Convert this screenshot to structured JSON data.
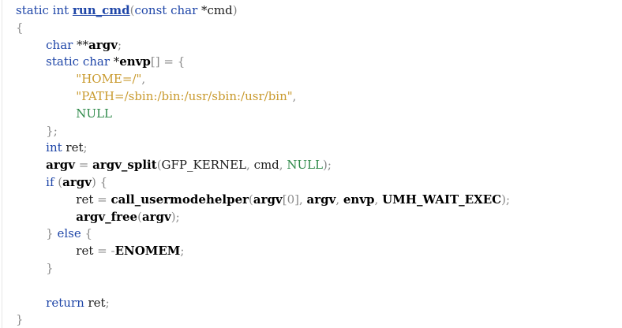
{
  "editor": {
    "lines": [
      [
        {
          "t": "static int ",
          "c": "kw"
        },
        {
          "t": "run_cmd",
          "c": "fn-def"
        },
        {
          "t": "(",
          "c": "punct"
        },
        {
          "t": "const char ",
          "c": "kw"
        },
        {
          "t": "*cmd",
          "c": "plain"
        },
        {
          "t": ")",
          "c": "punct"
        }
      ],
      [
        {
          "t": "{",
          "c": "punct"
        }
      ],
      [
        {
          "t": "        ",
          "c": "plain"
        },
        {
          "t": "char ",
          "c": "kw"
        },
        {
          "t": "**",
          "c": "plain"
        },
        {
          "t": "argv",
          "c": "bold"
        },
        {
          "t": ";",
          "c": "punct"
        }
      ],
      [
        {
          "t": "        ",
          "c": "plain"
        },
        {
          "t": "static char ",
          "c": "kw"
        },
        {
          "t": "*",
          "c": "plain"
        },
        {
          "t": "envp",
          "c": "bold"
        },
        {
          "t": "[] = {",
          "c": "punct"
        }
      ],
      [
        {
          "t": "                ",
          "c": "plain"
        },
        {
          "t": "\"HOME=/\"",
          "c": "str"
        },
        {
          "t": ",",
          "c": "punct"
        }
      ],
      [
        {
          "t": "                ",
          "c": "plain"
        },
        {
          "t": "\"PATH=/sbin:/bin:/usr/sbin:/usr/bin\"",
          "c": "str"
        },
        {
          "t": ",",
          "c": "punct"
        }
      ],
      [
        {
          "t": "                ",
          "c": "plain"
        },
        {
          "t": "NULL",
          "c": "const"
        }
      ],
      [
        {
          "t": "        ",
          "c": "plain"
        },
        {
          "t": "};",
          "c": "punct"
        }
      ],
      [
        {
          "t": "        ",
          "c": "plain"
        },
        {
          "t": "int ",
          "c": "kw"
        },
        {
          "t": "ret",
          "c": "plain"
        },
        {
          "t": ";",
          "c": "punct"
        }
      ],
      [
        {
          "t": "        ",
          "c": "plain"
        },
        {
          "t": "argv",
          "c": "bold"
        },
        {
          "t": " = ",
          "c": "punct"
        },
        {
          "t": "argv_split",
          "c": "bold"
        },
        {
          "t": "(",
          "c": "punct"
        },
        {
          "t": "GFP_KERNEL",
          "c": "plain"
        },
        {
          "t": ", ",
          "c": "punct"
        },
        {
          "t": "cmd",
          "c": "plain"
        },
        {
          "t": ", ",
          "c": "punct"
        },
        {
          "t": "NULL",
          "c": "const"
        },
        {
          "t": ");",
          "c": "punct"
        }
      ],
      [
        {
          "t": "        ",
          "c": "plain"
        },
        {
          "t": "if ",
          "c": "kw"
        },
        {
          "t": "(",
          "c": "punct"
        },
        {
          "t": "argv",
          "c": "bold"
        },
        {
          "t": ") {",
          "c": "punct"
        }
      ],
      [
        {
          "t": "                ",
          "c": "plain"
        },
        {
          "t": "ret",
          "c": "plain"
        },
        {
          "t": " = ",
          "c": "punct"
        },
        {
          "t": "call_usermodehelper",
          "c": "bold"
        },
        {
          "t": "(",
          "c": "punct"
        },
        {
          "t": "argv",
          "c": "bold"
        },
        {
          "t": "[0], ",
          "c": "punct"
        },
        {
          "t": "argv",
          "c": "bold"
        },
        {
          "t": ", ",
          "c": "punct"
        },
        {
          "t": "envp",
          "c": "bold"
        },
        {
          "t": ", ",
          "c": "punct"
        },
        {
          "t": "UMH_WAIT_EXEC",
          "c": "bold"
        },
        {
          "t": ");",
          "c": "punct"
        }
      ],
      [
        {
          "t": "                ",
          "c": "plain"
        },
        {
          "t": "argv_free",
          "c": "bold"
        },
        {
          "t": "(",
          "c": "punct"
        },
        {
          "t": "argv",
          "c": "bold"
        },
        {
          "t": ");",
          "c": "punct"
        }
      ],
      [
        {
          "t": "        ",
          "c": "plain"
        },
        {
          "t": "} ",
          "c": "punct"
        },
        {
          "t": "else ",
          "c": "kw"
        },
        {
          "t": "{",
          "c": "punct"
        }
      ],
      [
        {
          "t": "                ",
          "c": "plain"
        },
        {
          "t": "ret",
          "c": "plain"
        },
        {
          "t": " = -",
          "c": "punct"
        },
        {
          "t": "ENOMEM",
          "c": "bold"
        },
        {
          "t": ";",
          "c": "punct"
        }
      ],
      [
        {
          "t": "        ",
          "c": "plain"
        },
        {
          "t": "}",
          "c": "punct"
        }
      ],
      [],
      [
        {
          "t": "        ",
          "c": "plain"
        },
        {
          "t": "return ",
          "c": "kw"
        },
        {
          "t": "ret",
          "c": "plain"
        },
        {
          "t": ";",
          "c": "punct"
        }
      ],
      [
        {
          "t": "}",
          "c": "punct"
        }
      ]
    ]
  },
  "colors": {
    "keyword": "#1f46a8",
    "string": "#c99a2e",
    "constant": "#2f8a4a",
    "punctuation": "#8a8a8a",
    "background": "#ffffff"
  }
}
